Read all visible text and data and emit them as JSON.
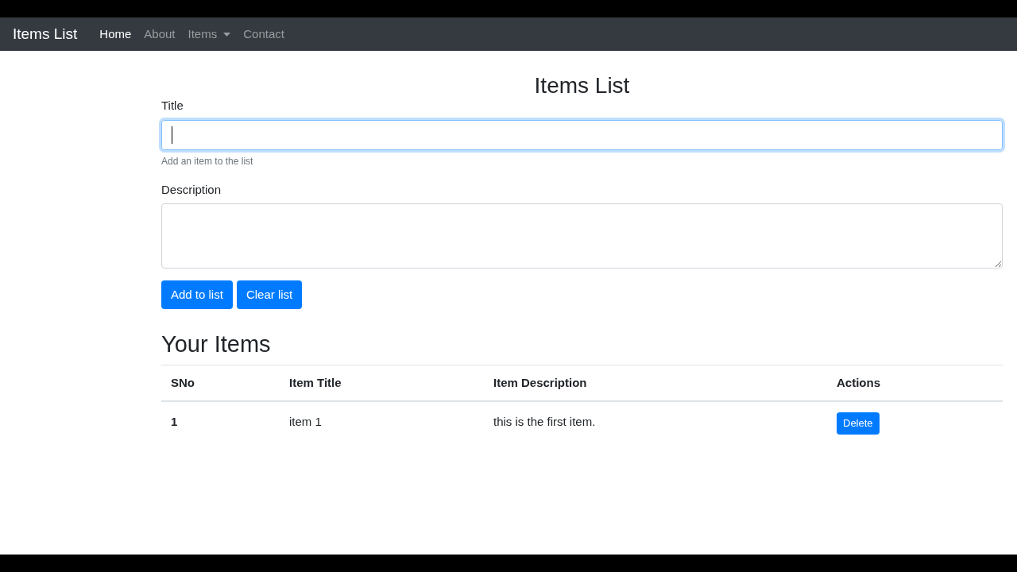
{
  "navbar": {
    "brand": "Items List",
    "links": [
      {
        "label": "Home",
        "selected": true,
        "kind": "link"
      },
      {
        "label": "About",
        "selected": false,
        "kind": "link"
      },
      {
        "label": "Items",
        "selected": false,
        "kind": "dropdown"
      },
      {
        "label": "Contact",
        "selected": false,
        "kind": "link"
      }
    ]
  },
  "heading": "Items List",
  "form": {
    "title_label": "Title",
    "title_focused": true,
    "title_help": "Add an item to the list",
    "description_label": "Description",
    "buttons": [
      "Add to list",
      "Clear list"
    ]
  },
  "items_heading": "Your Items",
  "table": {
    "columns": [
      "SNo",
      "Item Title",
      "Item Description",
      "Actions"
    ],
    "rows": [
      {
        "sno": "1",
        "title": "item 1",
        "description": "this is the first item.",
        "action": "Delete"
      }
    ]
  }
}
